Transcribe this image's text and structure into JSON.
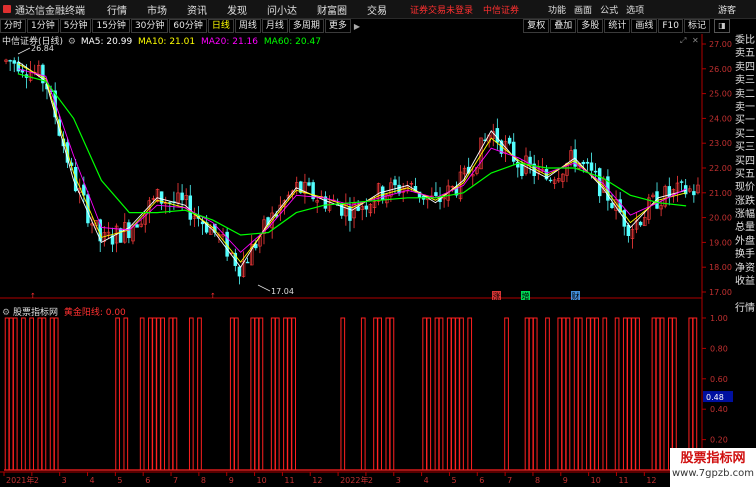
{
  "app": {
    "name": "通达信金融终端",
    "menus": [
      "行情",
      "市场",
      "资讯",
      "发现",
      "问小达",
      "财富圈",
      "交易"
    ],
    "status_login": "证券交易未登录",
    "broker": "中信证券",
    "right_menus": [
      "功能",
      "画面",
      "公式",
      "选项"
    ],
    "guest": "游客"
  },
  "toolbar": {
    "periods": [
      "分时",
      "1分钟",
      "5分钟",
      "15分钟",
      "30分钟",
      "60分钟",
      "日线",
      "周线",
      "月线",
      "多周期",
      "更多"
    ],
    "active_period": "日线",
    "right_buttons": [
      "复权",
      "叠加",
      "多股",
      "统计",
      "画线",
      "F10",
      "标记"
    ]
  },
  "colors": {
    "up": "#ff3c3c",
    "down": "#54ffff",
    "ma5": "#ffffff",
    "ma10": "#ffff00",
    "ma20": "#ff00ff",
    "ma60": "#00ff00",
    "indicator": "#ff2020",
    "axis": "#b00000"
  },
  "main_chart": {
    "stock_label": "中信证券(日线)",
    "ma5_label": "MA5: 20.99",
    "ma10_label": "MA10: 21.01",
    "ma20_label": "MA20: 21.16",
    "ma60_label": "MA60: 20.47",
    "high_marker": "26.84",
    "low_marker": "17.04",
    "price_ticks": [
      "27.00",
      "26.00",
      "25.00",
      "24.00",
      "23.00",
      "22.00",
      "21.00",
      "20.00",
      "19.00",
      "18.00",
      "17.00"
    ],
    "event_markers": [
      {
        "label": "涨",
        "color": "#ff4040"
      },
      {
        "label": "增",
        "color": "#00ff66"
      },
      {
        "label": "财",
        "color": "#4da6ff"
      }
    ]
  },
  "sub_chart": {
    "indicator_site": "股票指标网",
    "line_label": "黄金阳线: 0.00",
    "ticks": [
      "1.00",
      "0.80",
      "0.60",
      "0.40",
      "0.20"
    ],
    "current_value": "0.48"
  },
  "side_panel": [
    "委比",
    "卖五",
    "卖四",
    "卖三",
    "卖二",
    "卖一",
    "买一",
    "买二",
    "买三",
    "买四",
    "买五",
    "现价",
    "涨跌",
    "涨幅",
    "总量",
    "外盘",
    "换手",
    "净资",
    "收益",
    "",
    "行情"
  ],
  "date_axis": [
    "2021年",
    "2",
    "3",
    "4",
    "5",
    "6",
    "7",
    "8",
    "9",
    "10",
    "11",
    "12",
    "2022年",
    "2",
    "3",
    "4",
    "5",
    "6",
    "7",
    "8",
    "9",
    "10",
    "11",
    "12",
    "1"
  ],
  "watermark": {
    "title": "股票指标网",
    "url": "www.7gpzb.com"
  },
  "chart_data": {
    "type": "line",
    "title": "中信证券(日线)",
    "xlabel": "",
    "ylabel": "",
    "ylim": [
      17.0,
      27.0
    ],
    "x": [
      "2021-01",
      "2021-02",
      "2021-03",
      "2021-04",
      "2021-05",
      "2021-06",
      "2021-07",
      "2021-08",
      "2021-09",
      "2021-10",
      "2021-11",
      "2021-12",
      "2022-01",
      "2022-02",
      "2022-03",
      "2022-04",
      "2022-05",
      "2022-06",
      "2022-07",
      "2022-08",
      "2022-09",
      "2022-10",
      "2022-11",
      "2022-12",
      "2023-01"
    ],
    "series": [
      {
        "name": "MA5",
        "values": [
          26.3,
          25.5,
          21.5,
          19.0,
          19.6,
          20.8,
          20.5,
          19.5,
          18.0,
          19.8,
          21.2,
          20.7,
          20.3,
          21.0,
          21.3,
          20.6,
          21.5,
          23.5,
          22.2,
          21.6,
          22.4,
          21.2,
          19.6,
          20.8,
          21.1
        ]
      },
      {
        "name": "MA10",
        "values": [
          26.2,
          25.6,
          21.8,
          19.2,
          19.5,
          20.7,
          20.4,
          19.6,
          18.2,
          19.7,
          21.1,
          20.8,
          20.4,
          20.9,
          21.2,
          20.7,
          21.4,
          23.2,
          22.3,
          21.7,
          22.3,
          21.3,
          19.8,
          20.7,
          21.0
        ]
      },
      {
        "name": "MA20",
        "values": [
          26.0,
          25.7,
          22.5,
          19.6,
          19.5,
          20.5,
          20.4,
          19.8,
          18.6,
          19.6,
          20.9,
          20.8,
          20.5,
          20.8,
          21.1,
          20.8,
          21.3,
          22.8,
          22.4,
          21.8,
          22.2,
          21.4,
          20.1,
          20.6,
          21.16
        ]
      },
      {
        "name": "MA60",
        "values": [
          25.8,
          25.5,
          24.0,
          21.5,
          20.2,
          20.2,
          20.3,
          19.9,
          19.3,
          19.4,
          20.2,
          20.5,
          20.6,
          20.7,
          20.8,
          20.8,
          21.0,
          21.8,
          22.2,
          22.0,
          22.0,
          21.6,
          20.9,
          20.6,
          20.47
        ]
      }
    ],
    "high": 26.84,
    "low": 17.04,
    "indicator": {
      "name": "黄金阳线",
      "ylim": [
        0,
        1
      ],
      "signal_months": [
        "2021-01",
        "2021-02",
        "2021-05",
        "2021-06",
        "2021-07",
        "2021-09",
        "2021-10",
        "2021-11",
        "2022-01",
        "2022-02",
        "2022-04",
        "2022-05",
        "2022-07",
        "2022-08",
        "2022-09",
        "2022-10",
        "2022-11",
        "2022-12",
        "2023-01"
      ]
    }
  }
}
